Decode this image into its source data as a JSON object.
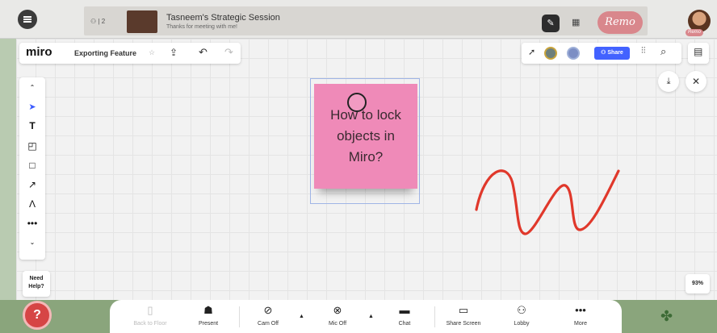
{
  "remo": {
    "people_count": "2",
    "session_title": "Tasneem's Strategic Session",
    "session_subtitle": "Thanks for meeting with me!",
    "logo": "Remo",
    "user_tag": "Remo"
  },
  "miro": {
    "logo": "miro",
    "board_name": "Exporting Feature",
    "share_label": "Share",
    "help_text": "Need Help?",
    "zoom": "93%"
  },
  "sticky": {
    "text": "How to lock objects in Miro?",
    "color": "#ef8ab8"
  },
  "squiggle_color": "#e0382b",
  "accent_color": "#4262ff",
  "bottom_bar": {
    "items": [
      {
        "label": "Back to Floor",
        "icon": "floor-icon"
      },
      {
        "label": "Present",
        "icon": "present-icon"
      },
      {
        "label": "Cam Off",
        "icon": "camera-off-icon"
      },
      {
        "label": "Mic Off",
        "icon": "mic-off-icon"
      },
      {
        "label": "Chat",
        "icon": "chat-icon"
      },
      {
        "label": "Share Screen",
        "icon": "share-screen-icon"
      },
      {
        "label": "Lobby",
        "icon": "lobby-icon"
      },
      {
        "label": "More",
        "icon": "more-icon"
      }
    ]
  }
}
